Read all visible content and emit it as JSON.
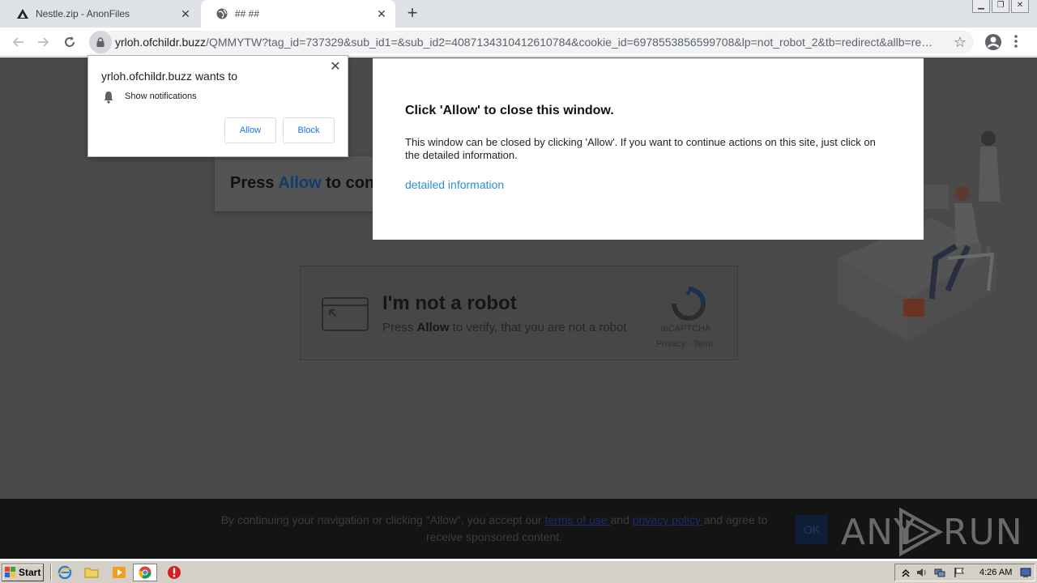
{
  "browser": {
    "tabs": [
      {
        "title": "Nestle.zip - AnonFiles",
        "icon": "anonfiles-icon",
        "active": false
      },
      {
        "title": "## ##",
        "icon": "globe-icon",
        "active": true
      }
    ],
    "url_host": "yrloh.ofchildr.buzz",
    "url_path": "/QMMYTW?tag_id=737329&sub_id1=&sub_id2=4087134310412610784&cookie_id=6978553856599708&lp=not_robot_2&tb=redirect&allb=redi..."
  },
  "permission_prompt": {
    "title": "yrloh.ofchildr.buzz wants to",
    "item": "Show notifications",
    "allow_label": "Allow",
    "block_label": "Block"
  },
  "modal": {
    "title": "Click 'Allow' to close this window.",
    "body": "This window can be closed by clicking 'Allow'. If you want to continue actions on this site, just click on the detailed information.",
    "link": "detailed information"
  },
  "page": {
    "press_prefix": "Press ",
    "press_allow": "Allow",
    "press_suffix": " to con",
    "captcha": {
      "title": "I'm not a robot",
      "sub_prefix": "Press ",
      "sub_allow": "Allow",
      "sub_suffix": " to verify, that you are not a robot",
      "recaptcha_label": "reCAPTCHA",
      "recaptcha_links": "Privacy - Term"
    }
  },
  "cookie_banner": {
    "text_before": "By continuing your navigation or clicking \"Allow\", you accept our ",
    "terms_link": "terms of use ",
    "and_text": "and ",
    "privacy_link": "privacy policy ",
    "text_after": "and agree to receive sponsored content.",
    "ok_label": "OK"
  },
  "watermark": {
    "left": "ANY",
    "right": "RUN"
  },
  "taskbar": {
    "start_label": "Start",
    "clock": "4:26 AM"
  },
  "colors": {
    "modal_link": "#2a8fd5",
    "allow_highlight": "#0e3e6e",
    "prompt_button_text": "#1a73e8"
  }
}
